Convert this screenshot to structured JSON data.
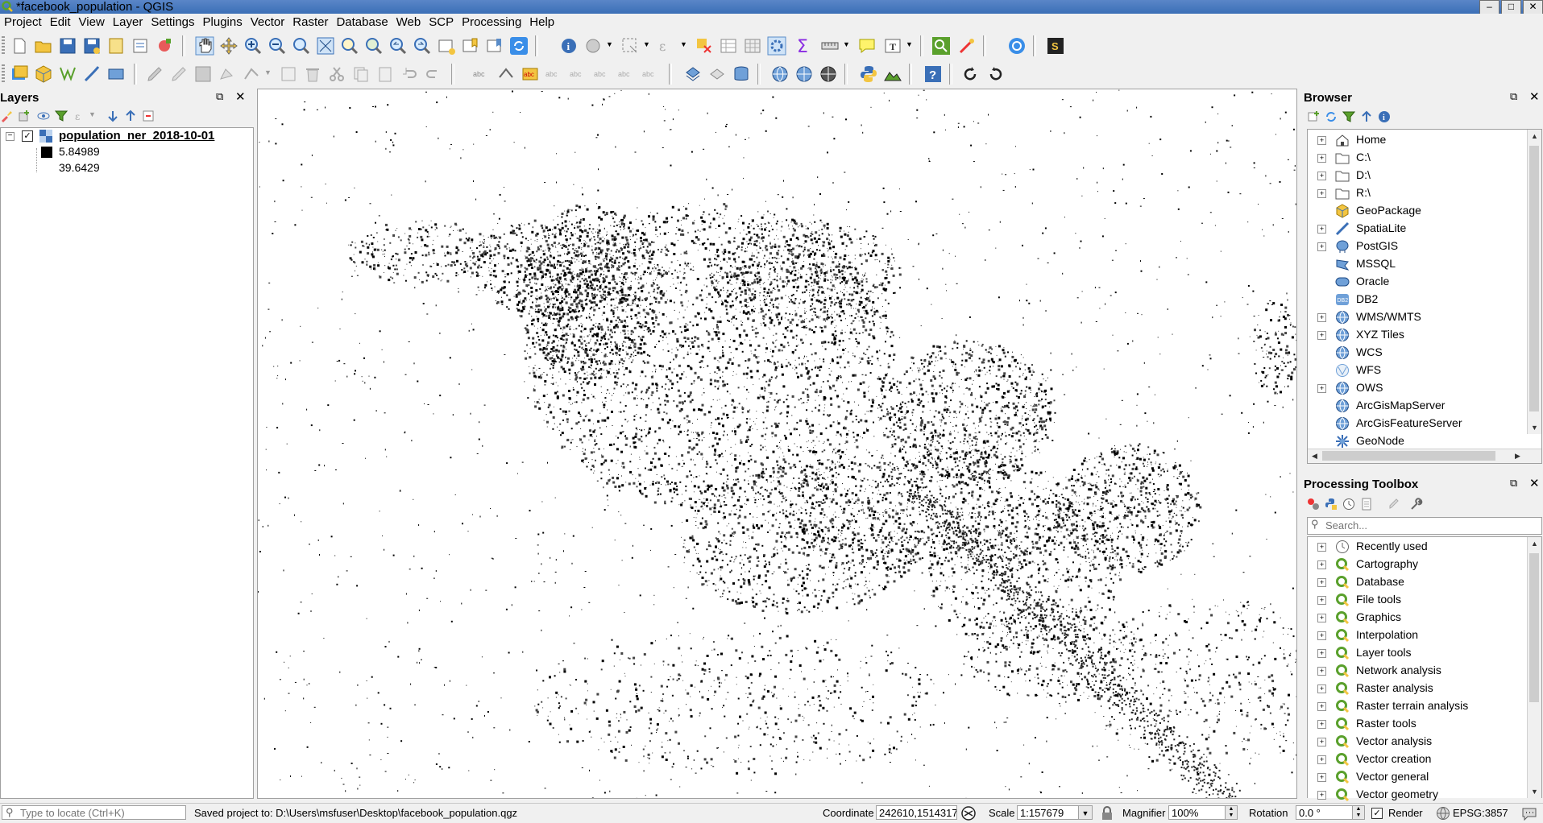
{
  "window": {
    "title": "*facebook_population - QGIS",
    "controls": [
      "–",
      "□",
      "✕"
    ]
  },
  "menu": [
    "Project",
    "Edit",
    "View",
    "Layer",
    "Settings",
    "Plugins",
    "Vector",
    "Raster",
    "Database",
    "Web",
    "SCP",
    "Processing",
    "Help"
  ],
  "layers_panel": {
    "title": "Layers",
    "layer": {
      "name": "population_ner_2018-10-01",
      "checked": true
    },
    "legend": [
      {
        "label": "5.84989",
        "color": "#000000"
      },
      {
        "label": "39.6429",
        "color": "#ffffff"
      }
    ]
  },
  "browser_panel": {
    "title": "Browser",
    "items": [
      {
        "label": "Home",
        "icon": "home-icon"
      },
      {
        "label": "C:\\",
        "icon": "folder-icon"
      },
      {
        "label": "D:\\",
        "icon": "folder-icon"
      },
      {
        "label": "R:\\",
        "icon": "folder-icon"
      },
      {
        "label": "GeoPackage",
        "icon": "geopackage-icon"
      },
      {
        "label": "SpatiaLite",
        "icon": "spatialite-icon"
      },
      {
        "label": "PostGIS",
        "icon": "postgis-icon"
      },
      {
        "label": "MSSQL",
        "icon": "mssql-icon"
      },
      {
        "label": "Oracle",
        "icon": "oracle-icon"
      },
      {
        "label": "DB2",
        "icon": "db2-icon"
      },
      {
        "label": "WMS/WMTS",
        "icon": "globe-icon"
      },
      {
        "label": "XYZ Tiles",
        "icon": "globe-icon"
      },
      {
        "label": "WCS",
        "icon": "globe-icon"
      },
      {
        "label": "WFS",
        "icon": "wfs-icon"
      },
      {
        "label": "OWS",
        "icon": "globe-icon"
      },
      {
        "label": "ArcGisMapServer",
        "icon": "globe-icon"
      },
      {
        "label": "ArcGisFeatureServer",
        "icon": "globe-icon"
      },
      {
        "label": "GeoNode",
        "icon": "geonode-icon"
      }
    ]
  },
  "processing_panel": {
    "title": "Processing Toolbox",
    "search_placeholder": "Search...",
    "items": [
      "Recently used",
      "Cartography",
      "Database",
      "File tools",
      "Graphics",
      "Interpolation",
      "Layer tools",
      "Network analysis",
      "Raster analysis",
      "Raster terrain analysis",
      "Raster tools",
      "Vector analysis",
      "Vector creation",
      "Vector general",
      "Vector geometry"
    ]
  },
  "statusbar": {
    "locate_placeholder": "Type to locate (Ctrl+K)",
    "message": "Saved project to: D:\\Users\\msfuser\\Desktop\\facebook_population.qgz",
    "coordinate_label": "Coordinate",
    "coordinate_value": "242610,1514317",
    "scale_label": "Scale",
    "scale_value": "1:157679",
    "magnifier_label": "Magnifier",
    "magnifier_value": "100%",
    "rotation_label": "Rotation",
    "rotation_value": "0.0 °",
    "render_label": "Render",
    "render_checked": true,
    "crs": "EPSG:3857"
  },
  "colors": {
    "accent": "#3b6fb6",
    "qgis_green": "#5aa02c"
  }
}
